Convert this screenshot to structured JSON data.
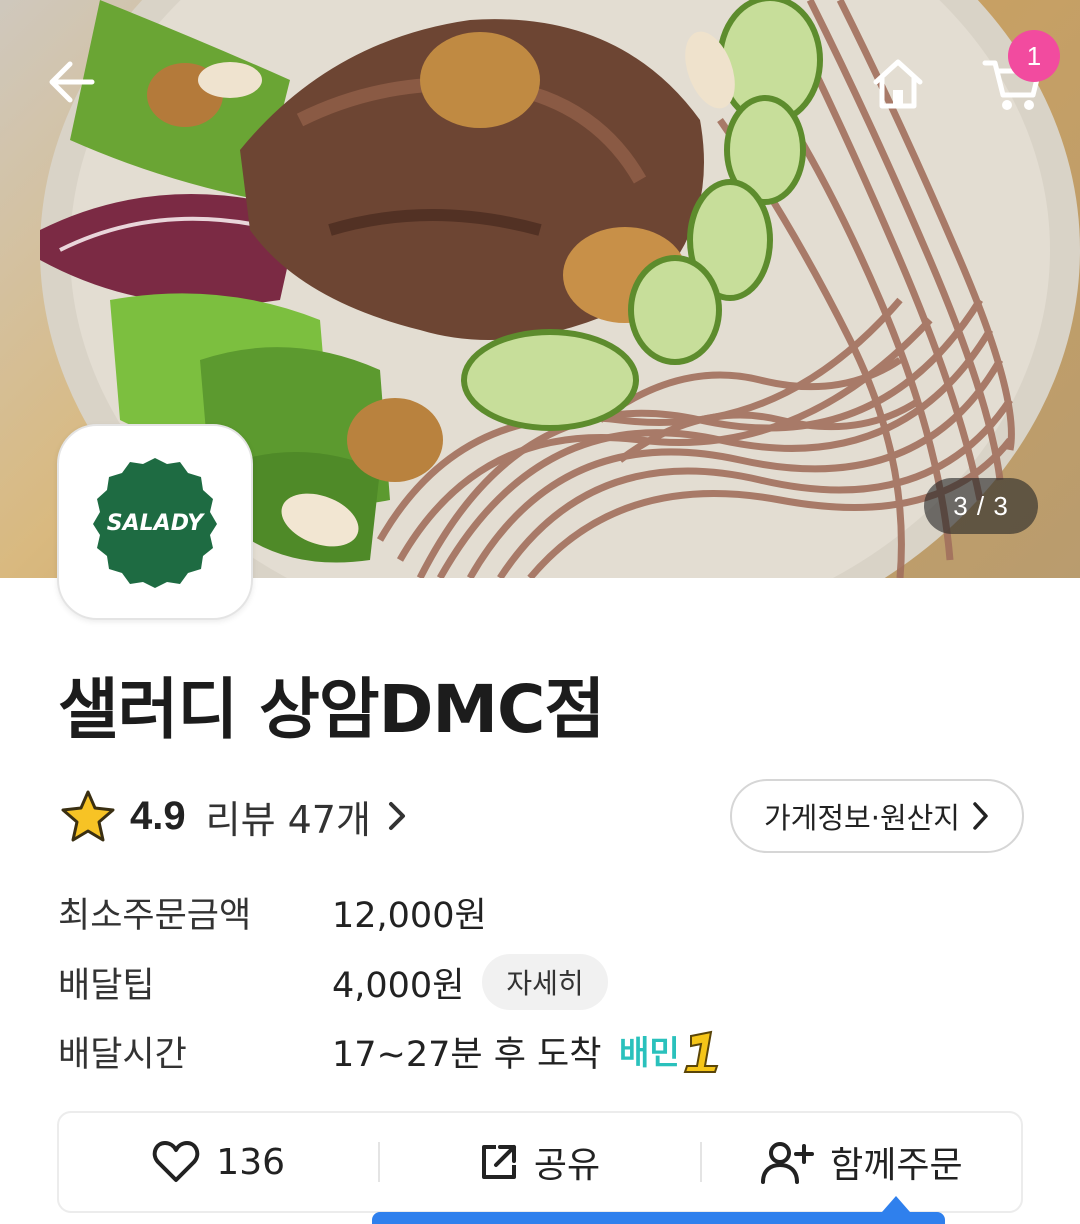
{
  "header": {
    "back_icon": "arrow-left-icon",
    "home_icon": "home-icon",
    "cart_icon": "cart-icon",
    "cart_count": "1",
    "image_counter": "3 / 3"
  },
  "store": {
    "logo_text": "SALADY",
    "name": "샐러디 상암DMC점",
    "rating": "4.9",
    "review_label": "리뷰 47개",
    "info_button_label": "가게정보·원산지"
  },
  "info": {
    "min_order_label": "최소주문금액",
    "min_order_value": "12,000원",
    "delivery_tip_label": "배달팁",
    "delivery_tip_value": "4,000원",
    "detail_button": "자세히",
    "delivery_time_label": "배달시간",
    "delivery_time_value": "17~27분 후 도착",
    "badge_text": "배민1"
  },
  "actions": {
    "like_count": "136",
    "share_label": "공유",
    "group_order_label": "함께주문"
  },
  "colors": {
    "brand_green": "#1e6b42",
    "badge_pink": "#f24b9f",
    "baemin_mint": "#2ac1bc",
    "accent_blue": "#2f80ed",
    "star_yellow": "#f7c325"
  }
}
